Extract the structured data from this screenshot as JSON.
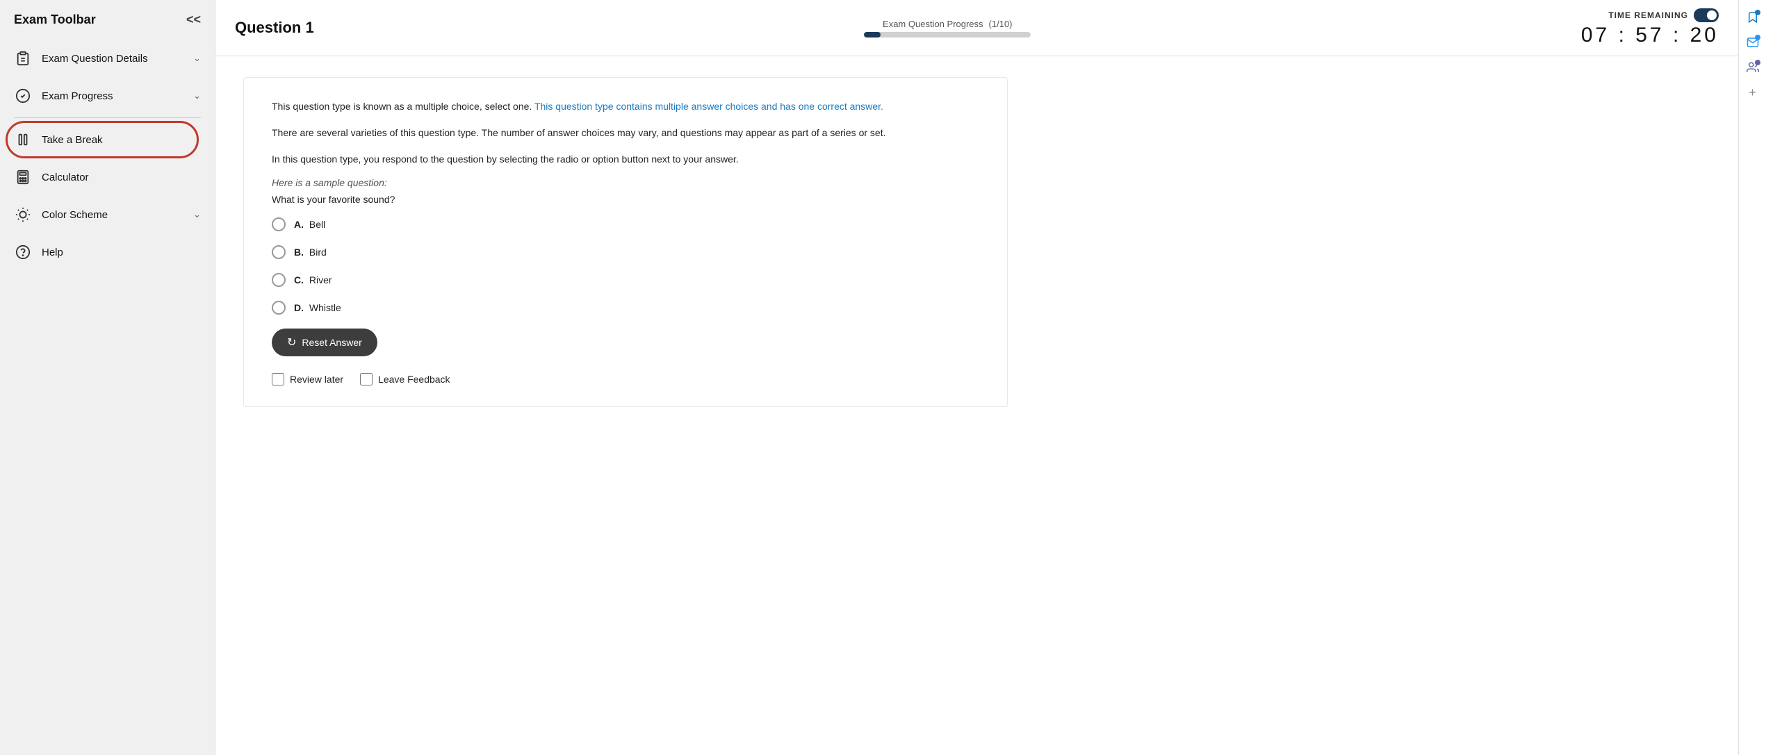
{
  "sidebar": {
    "title": "Exam Toolbar",
    "collapse_label": "<<",
    "items": [
      {
        "id": "exam-question-details",
        "label": "Exam Question Details",
        "icon": "clipboard",
        "has_chevron": true
      },
      {
        "id": "exam-progress",
        "label": "Exam Progress",
        "icon": "check-circle",
        "has_chevron": true
      },
      {
        "id": "take-a-break",
        "label": "Take a Break",
        "icon": "pause",
        "has_chevron": false,
        "highlighted": true
      },
      {
        "id": "calculator",
        "label": "Calculator",
        "icon": "grid",
        "has_chevron": false
      },
      {
        "id": "color-scheme",
        "label": "Color Scheme",
        "icon": "sun",
        "has_chevron": true
      },
      {
        "id": "help",
        "label": "Help",
        "icon": "question",
        "has_chevron": false
      }
    ]
  },
  "header": {
    "question_title": "Question 1",
    "progress_label": "Exam Question Progress",
    "progress_count": "(1/10)",
    "progress_percent": 10,
    "timer_label": "TIME REMAINING",
    "timer_value": "07 : 57 : 20"
  },
  "question": {
    "paragraphs": [
      {
        "text_normal": "This question type is known as a multiple choice, select one. ",
        "text_highlight": "This question type contains multiple answer choices and has one correct answer."
      },
      {
        "text_normal": "There are several varieties of this question type. The number of answer choices may vary, and questions may appear as part of a series or set.",
        "text_highlight": ""
      },
      {
        "text_normal": "In this question type, you respond to the question by selecting the radio or option button next to your answer.",
        "text_highlight": ""
      }
    ],
    "sample_label": "Here is a sample question:",
    "prompt": "What is your favorite sound?",
    "options": [
      {
        "letter": "A.",
        "text": "Bell"
      },
      {
        "letter": "B.",
        "text": "Bird"
      },
      {
        "letter": "C.",
        "text": "River"
      },
      {
        "letter": "D.",
        "text": "Whistle"
      }
    ],
    "reset_button_label": "Reset Answer",
    "review_later_label": "Review later",
    "leave_feedback_label": "Leave Feedback"
  },
  "right_sidebar": {
    "icons": [
      "bookmark",
      "mail",
      "teams",
      "plus"
    ]
  }
}
